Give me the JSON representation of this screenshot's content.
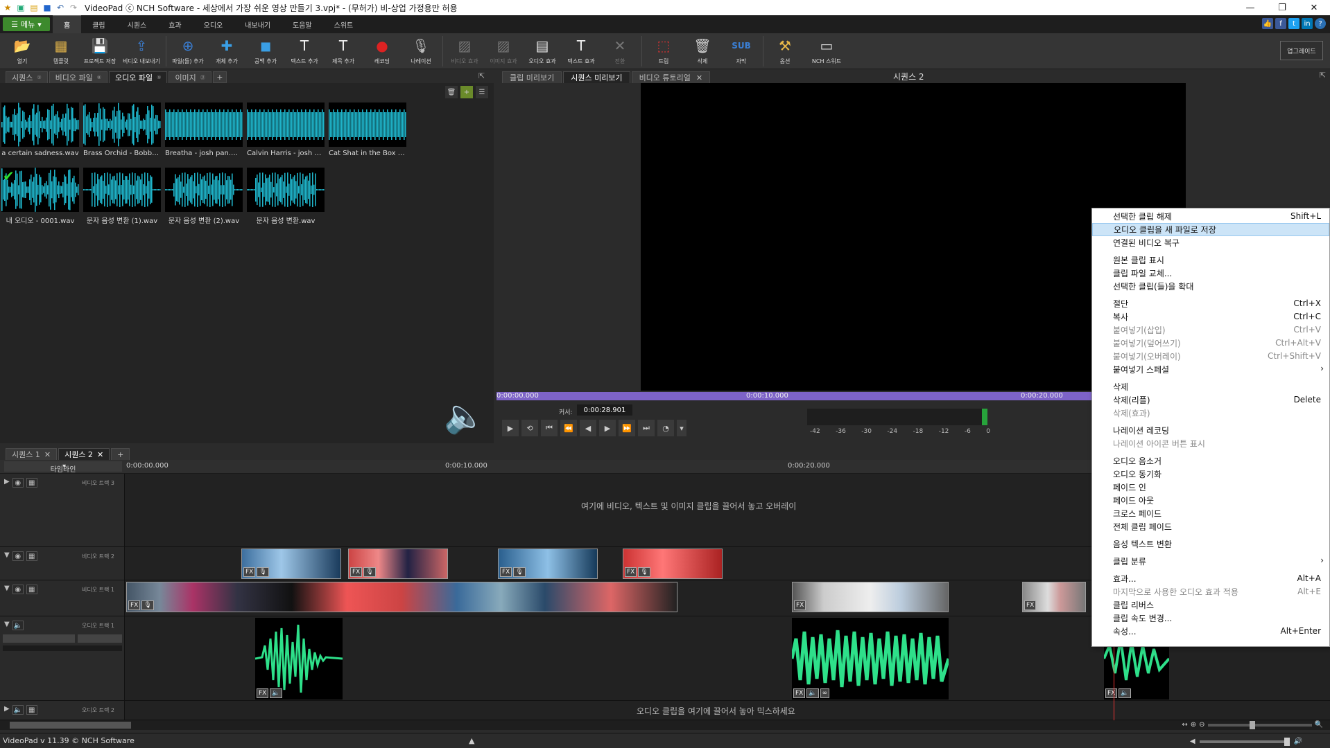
{
  "window": {
    "title": "VideoPad ⓒ NCH Software - 세상에서 가장 쉬운 영상 만들기 3.vpj* - (무허가) 비-상업 가정용만 허용",
    "minimize": "—",
    "restore": "❐",
    "close": "✕"
  },
  "menu": {
    "menu_button": "메뉴",
    "tabs": [
      "홈",
      "클립",
      "시퀀스",
      "효과",
      "오디오",
      "내보내기",
      "도움말",
      "스위트"
    ]
  },
  "toolbar": {
    "buttons": [
      {
        "label": "열기",
        "icon": "folder-open-icon"
      },
      {
        "label": "템플릿",
        "icon": "template-icon"
      },
      {
        "label": "프로젝트 저장",
        "icon": "save-icon"
      },
      {
        "label": "비디오 내보내기",
        "icon": "export-icon"
      },
      {
        "label": "파일(들) 추가",
        "icon": "add-files-icon"
      },
      {
        "label": "개체 추가",
        "icon": "add-object-icon"
      },
      {
        "label": "공백 추가",
        "icon": "add-blank-icon"
      },
      {
        "label": "텍스트 추가",
        "icon": "add-text-icon"
      },
      {
        "label": "제목 추가",
        "icon": "add-title-icon"
      },
      {
        "label": "레코딩",
        "icon": "record-icon"
      },
      {
        "label": "나레이션",
        "icon": "microphone-icon"
      },
      {
        "label": "비디오 효과",
        "icon": "video-fx-icon"
      },
      {
        "label": "이미지 효과",
        "icon": "image-fx-icon"
      },
      {
        "label": "오디오 효과",
        "icon": "audio-fx-icon"
      },
      {
        "label": "텍스트 효과",
        "icon": "text-fx-icon"
      },
      {
        "label": "전환",
        "icon": "transition-icon"
      },
      {
        "label": "트림",
        "icon": "trim-icon"
      },
      {
        "label": "삭제",
        "icon": "delete-icon"
      },
      {
        "label": "자막",
        "icon": "subtitle-icon"
      },
      {
        "label": "옵션",
        "icon": "options-icon"
      },
      {
        "label": "NCH 스위트",
        "icon": "nch-suite-icon"
      }
    ],
    "upgrade": "업그레이드"
  },
  "bin": {
    "tabs": [
      {
        "label": "시퀀스",
        "count": "①"
      },
      {
        "label": "비디오 파일",
        "count": "⑧"
      },
      {
        "label": "오디오 파일",
        "count": "⑨"
      },
      {
        "label": "이미지",
        "count": "㉑"
      }
    ],
    "clips": [
      {
        "name": "a certain sadness.wav"
      },
      {
        "name": "Brass Orchid - Bobby ..."
      },
      {
        "name": "Breatha - josh pan.mp3"
      },
      {
        "name": "Calvin Harris - josh p..."
      },
      {
        "name": "Cat Shat in the Box - J..."
      },
      {
        "name": "내 오디오 - 0001.wav"
      },
      {
        "name": "문자 음성 변환 (1).wav"
      },
      {
        "name": "문자 음성 변환 (2).wav"
      },
      {
        "name": "문자 음성 변환.wav"
      }
    ]
  },
  "preview": {
    "tabs": [
      "클립 미리보기",
      "시퀀스 미리보기",
      "비디오 튜토리얼"
    ],
    "title": "시퀀스 2",
    "scrub_labels": [
      "0:00:00.000",
      "0:00:10.000",
      "0:00:20.000"
    ],
    "cursor_label": "커서:",
    "cursor_value": "0:00:28.901",
    "meter_ticks": [
      "-42",
      "-36",
      "-30",
      "-24",
      "-18",
      "-12",
      "-6",
      "0"
    ]
  },
  "timeline": {
    "tabs": [
      "시퀀스 1",
      "시퀀스 2"
    ],
    "dropdown": "타임라인",
    "ruler_labels": [
      "0:00:00.000",
      "0:00:10.000",
      "0:00:20.000"
    ],
    "tracks": {
      "video3": "비디오 트랙 3",
      "video2": "비디오 트랙 2",
      "video1": "비디오 트랙 1",
      "audio1": "오디오 트랙 1",
      "audio2": "오디오 트랙 2"
    },
    "overlay_msg": "여기에 비디오, 텍스트 및 이미지 클립을 끌어서 놓고 오버레이",
    "mix_msg": "오디오 클립을 여기에 끌어서 놓아 믹스하세요"
  },
  "status": {
    "version": "VideoPad v 11.39 © NCH Software"
  },
  "context_menu": {
    "items": [
      {
        "label": "선택한 클립 해제",
        "shortcut": "Shift+L"
      },
      {
        "label": "오디오 클립을 새 파일로 저장",
        "highlight": true
      },
      {
        "label": "연결된 비디오 복구"
      },
      {
        "sep": true
      },
      {
        "label": "원본 클립 표시"
      },
      {
        "label": "클립 파일 교체..."
      },
      {
        "label": "선택한 클립(들)을 확대"
      },
      {
        "sep": true
      },
      {
        "label": "절단",
        "shortcut": "Ctrl+X"
      },
      {
        "label": "복사",
        "shortcut": "Ctrl+C"
      },
      {
        "label": "붙여넣기(삽입)",
        "shortcut": "Ctrl+V",
        "disabled": true
      },
      {
        "label": "붙여넣기(덮어쓰기)",
        "shortcut": "Ctrl+Alt+V",
        "disabled": true
      },
      {
        "label": "붙여넣기(오버레이)",
        "shortcut": "Ctrl+Shift+V",
        "disabled": true
      },
      {
        "label": "붙여넣기 스페셜",
        "submenu": true
      },
      {
        "sep": true
      },
      {
        "label": "삭제"
      },
      {
        "label": "삭제(리플)",
        "shortcut": "Delete"
      },
      {
        "label": "삭제(효과)",
        "disabled": true
      },
      {
        "sep": true
      },
      {
        "label": "나레이션 레코딩"
      },
      {
        "label": "나레이션 아이콘 버튼 표시",
        "disabled": true
      },
      {
        "sep": true
      },
      {
        "label": "오디오 음소거"
      },
      {
        "label": "오디오 동기화"
      },
      {
        "label": "페이드 인"
      },
      {
        "label": "페이드 아웃"
      },
      {
        "label": "크로스 페이드"
      },
      {
        "label": "전체 클립 페이드"
      },
      {
        "sep": true
      },
      {
        "label": "음성 텍스트 변환"
      },
      {
        "sep": true
      },
      {
        "label": "클립 분류",
        "submenu": true
      },
      {
        "sep": true
      },
      {
        "label": "효과...",
        "shortcut": "Alt+A"
      },
      {
        "label": "마지막으로 사용한 오디오 효과 적용",
        "shortcut": "Alt+E",
        "disabled": true
      },
      {
        "label": "클립 리버스"
      },
      {
        "label": "클립 속도 변경..."
      },
      {
        "label": "속성...",
        "shortcut": "Alt+Enter"
      }
    ]
  },
  "colors": {
    "menu_green": "#3d8a2d",
    "waveform_cyan": "#1fb3c9",
    "waveform_green": "#2ee08a",
    "scrub_purple": "#7d63c7"
  }
}
